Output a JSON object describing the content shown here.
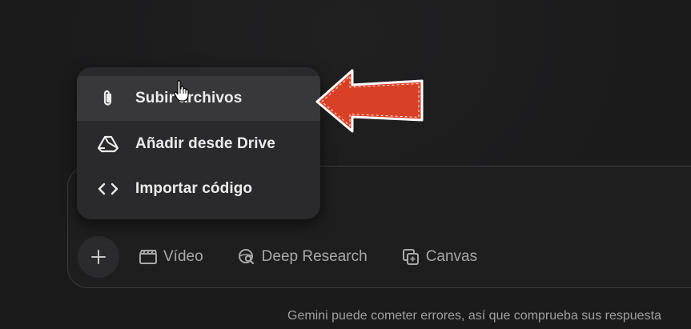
{
  "menu": {
    "items": [
      {
        "label": "Subir archivos",
        "icon": "paperclip-icon"
      },
      {
        "label": "Añadir desde Drive",
        "icon": "drive-icon"
      },
      {
        "label": "Importar código",
        "icon": "code-icon"
      }
    ]
  },
  "toolbar": {
    "video_label": "Vídeo",
    "deep_research_label": "Deep Research",
    "canvas_label": "Canvas"
  },
  "footer": {
    "disclaimer": "Gemini puede cometer errores, así que comprueba sus respuesta"
  },
  "colors": {
    "background": "#1b1b1c",
    "menu_bg": "#2a2a2c",
    "menu_hover": "#38383b",
    "arrow_red": "#d94126",
    "muted_text": "#a8a8a8"
  }
}
